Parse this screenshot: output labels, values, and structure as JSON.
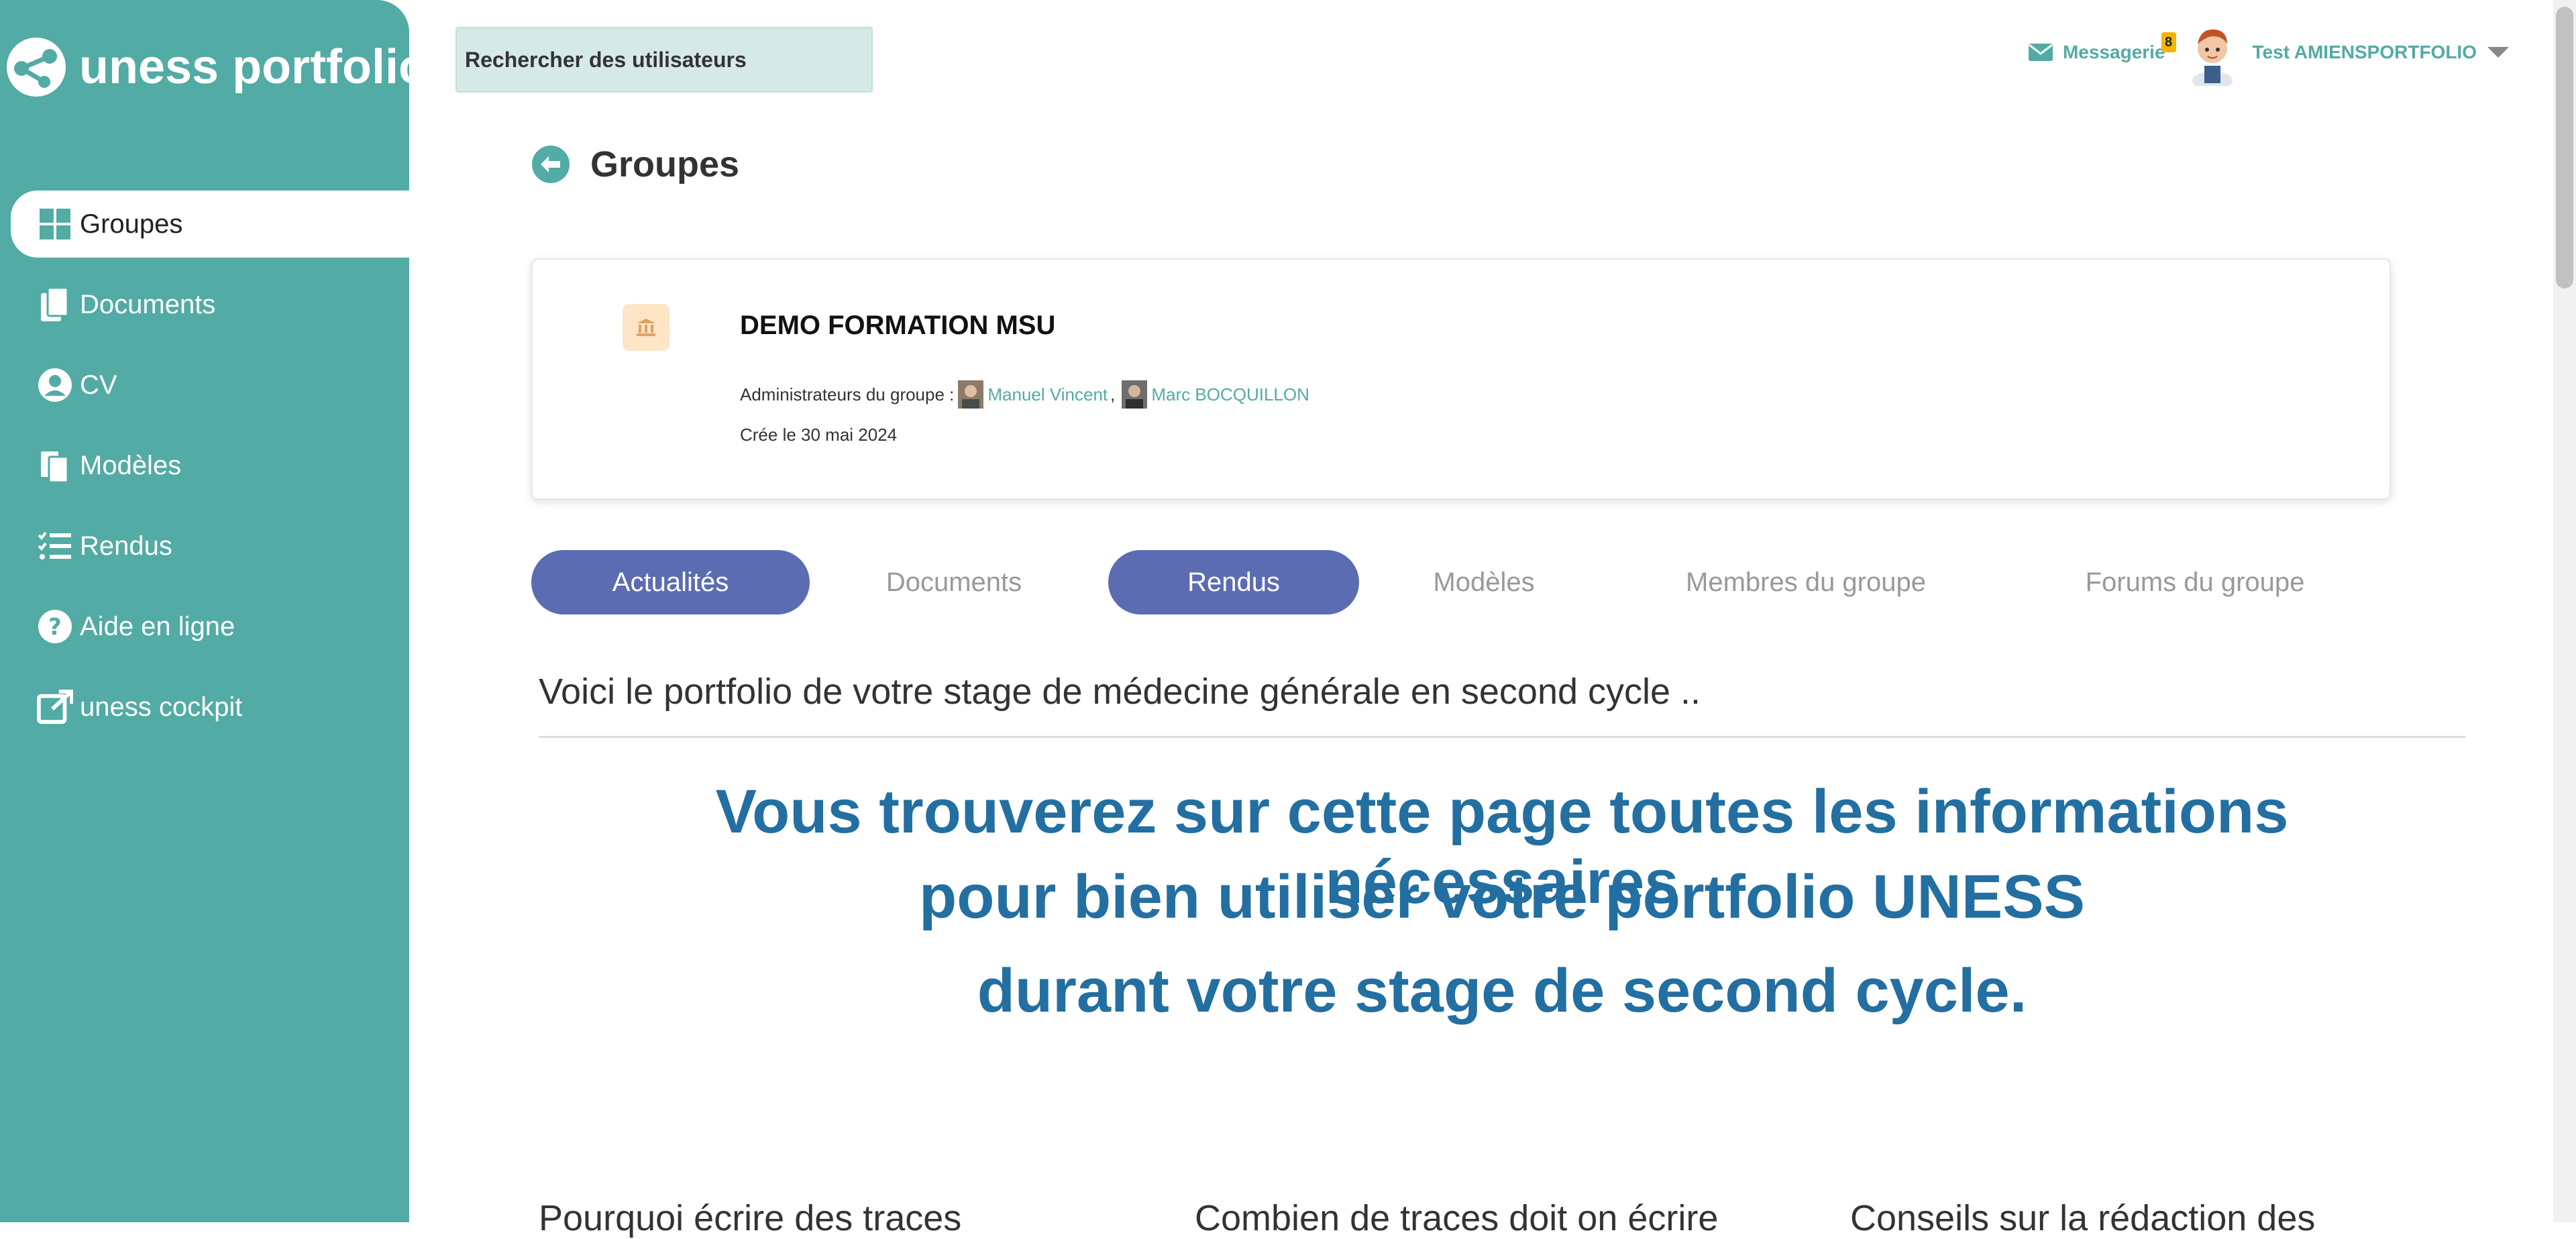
{
  "app": {
    "brand": "uness portfolio"
  },
  "search": {
    "label": "Rechercher des utilisateurs"
  },
  "header": {
    "messages_label": "Messagerie",
    "messages_badge": "8",
    "user_name": "Test AMIENSPORTFOLIO"
  },
  "sidebar": {
    "items": [
      {
        "label": "Groupes",
        "icon": "grid-icon",
        "active": true
      },
      {
        "label": "Documents",
        "icon": "documents-icon",
        "active": false
      },
      {
        "label": "CV",
        "icon": "user-circle-icon",
        "active": false
      },
      {
        "label": "Modèles",
        "icon": "templates-icon",
        "active": false
      },
      {
        "label": "Rendus",
        "icon": "checklist-icon",
        "active": false
      },
      {
        "label": "Aide en ligne",
        "icon": "question-icon",
        "active": false
      },
      {
        "label": "uness cockpit",
        "icon": "external-link-icon",
        "active": false
      }
    ]
  },
  "page": {
    "title": "Groupes"
  },
  "group": {
    "name": "DEMO FORMATION MSU",
    "admins_label": "Administrateurs du groupe :",
    "admins": [
      "Manuel Vincent",
      "Marc BOCQUILLON"
    ],
    "admins_sep": ",",
    "created": "Crée le 30 mai 2024"
  },
  "tabs": [
    {
      "label": "Actualités",
      "active": true
    },
    {
      "label": "Documents",
      "active": false
    },
    {
      "label": "Rendus",
      "active": true
    },
    {
      "label": "Modèles",
      "active": false
    },
    {
      "label": "Membres du groupe",
      "active": false
    },
    {
      "label": "Forums du groupe",
      "active": false
    }
  ],
  "content": {
    "intro": "Voici le portfolio de votre stage de médecine générale en second cycle ..",
    "headline_line1": "Vous trouverez sur cette page toutes les informations nécessaires",
    "headline_line2": "pour bien utiliser votre portfolio UNESS",
    "headline_line3": "durant votre stage de second cycle.",
    "columns": [
      "Pourquoi écrire des traces",
      "Combien de traces doit on écrire",
      "Conseils sur la rédaction des"
    ]
  },
  "colors": {
    "sidebar": "#52aba4",
    "tab_active": "#5b6cb3",
    "headline": "#236fa1",
    "badge": "#f4b400"
  }
}
